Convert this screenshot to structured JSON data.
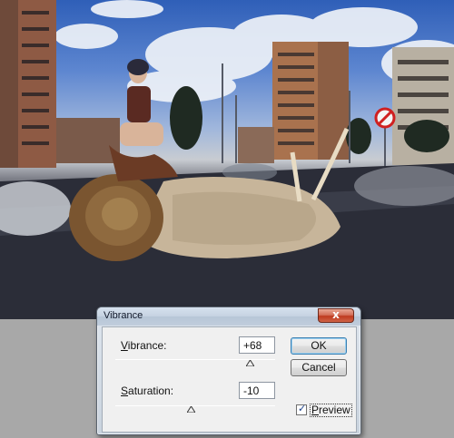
{
  "dialog": {
    "title": "Vibrance",
    "close_glyph": "x",
    "vibrance": {
      "label_hotkey": "V",
      "label_rest": "ibrance:",
      "value": "+68",
      "slider_fraction": 0.84
    },
    "saturation": {
      "label_hotkey": "S",
      "label_rest": "aturation:",
      "value": "-10",
      "slider_fraction": 0.45
    },
    "buttons": {
      "ok": "OK",
      "cancel": "Cancel"
    },
    "preview": {
      "hotkey": "P",
      "rest": "review",
      "checked": true,
      "check_glyph": "✓"
    }
  },
  "colors": {
    "accent": "#3c7fb1",
    "close_red": "#c8442a",
    "sign_red": "#d02020"
  },
  "icons": [
    "close-icon",
    "check-icon",
    "slider-thumb-icon"
  ]
}
